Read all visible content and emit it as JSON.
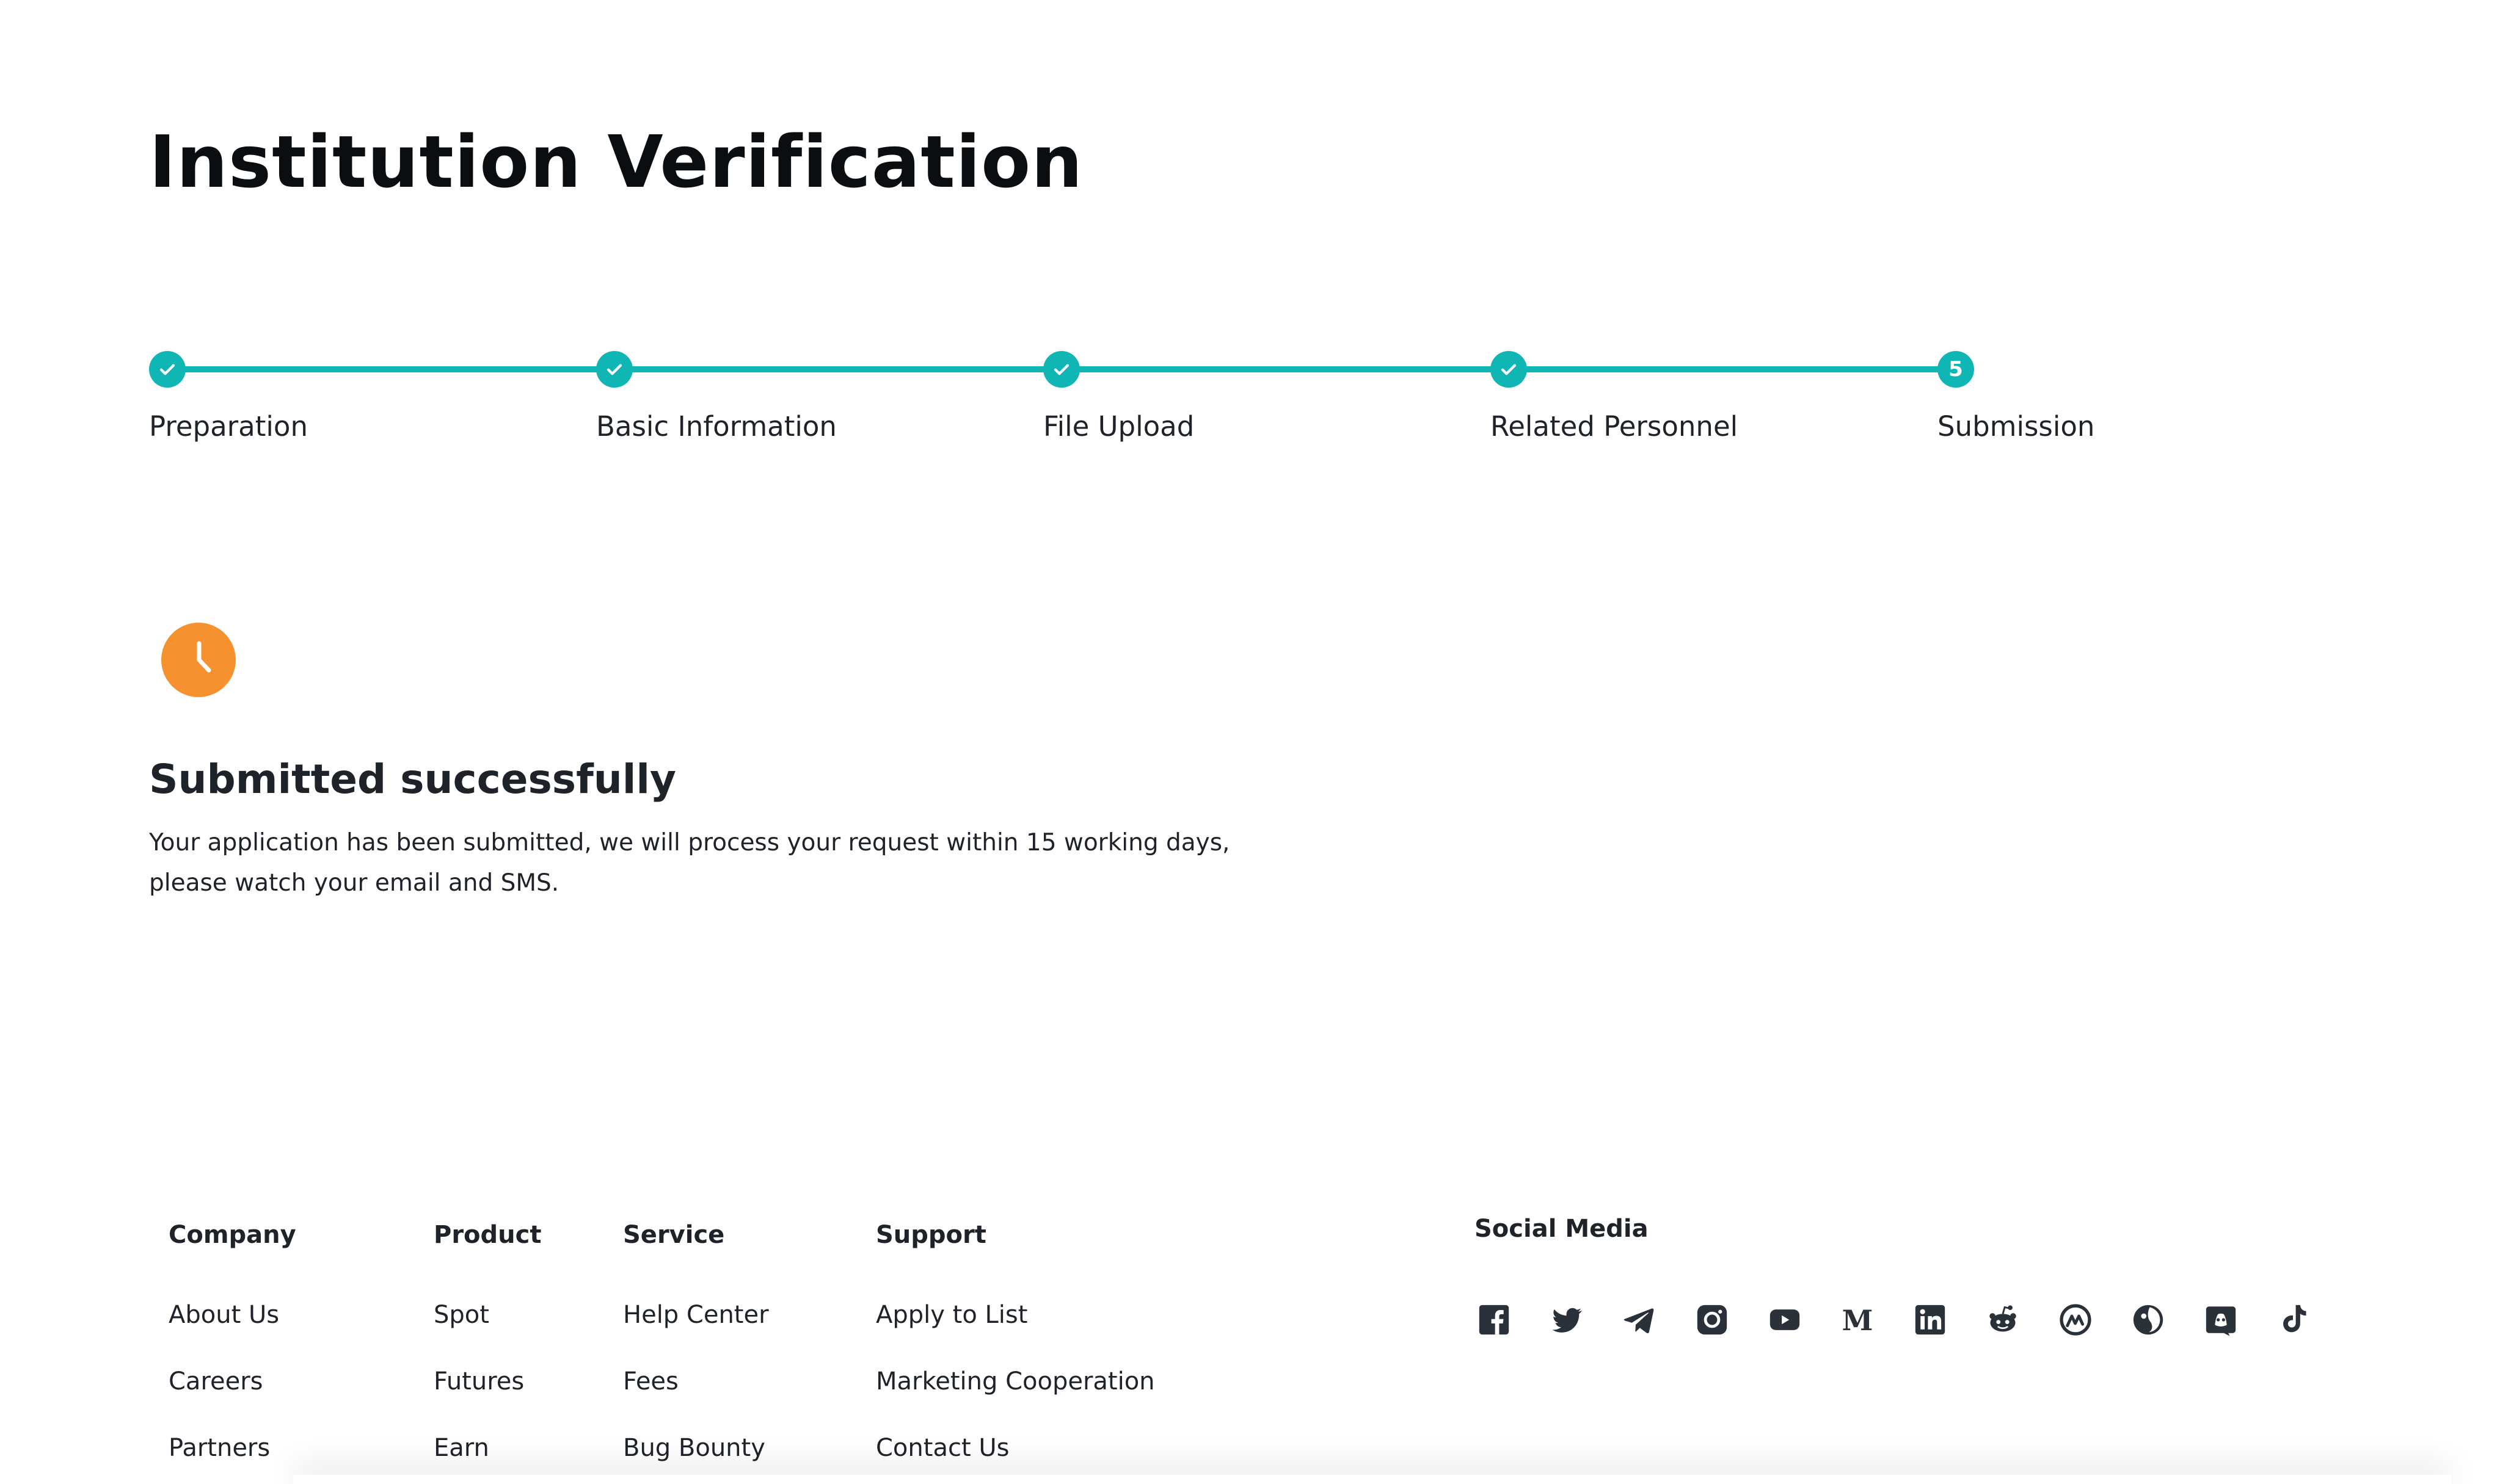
{
  "page": {
    "title": "Institution Verification"
  },
  "stepper": {
    "steps": [
      {
        "label": "Preparation",
        "state": "done"
      },
      {
        "label": "Basic Information",
        "state": "done"
      },
      {
        "label": "File Upload",
        "state": "done"
      },
      {
        "label": "Related Personnel",
        "state": "done"
      },
      {
        "label": "Submission",
        "state": "current",
        "number": "5"
      }
    ],
    "accent": "#10b6b3"
  },
  "result": {
    "icon": "clock-icon",
    "icon_color": "#f5922f",
    "title": "Submitted successfully",
    "description": "Your application has been submitted, we will process your request within 15 working days, please watch your email and SMS."
  },
  "footer": {
    "columns": [
      {
        "heading": "Company",
        "links": [
          "About Us",
          "Careers",
          "Partners"
        ]
      },
      {
        "heading": "Product",
        "links": [
          "Spot",
          "Futures",
          "Earn"
        ]
      },
      {
        "heading": "Service",
        "links": [
          "Help Center",
          "Fees",
          "Bug Bounty"
        ]
      },
      {
        "heading": "Support",
        "links": [
          "Apply to List",
          "Marketing Cooperation",
          "Contact Us"
        ]
      }
    ],
    "social": {
      "heading": "Social Media",
      "icons": [
        "facebook-icon",
        "twitter-icon",
        "telegram-icon",
        "instagram-icon",
        "youtube-icon",
        "medium-icon",
        "linkedin-icon",
        "reddit-icon",
        "coinmarketcap-icon",
        "coingecko-icon",
        "discord-icon",
        "tiktok-icon"
      ]
    }
  }
}
